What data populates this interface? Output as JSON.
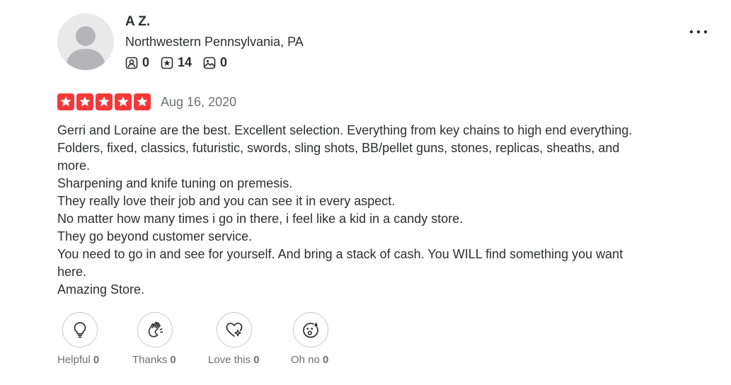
{
  "user": {
    "name": "A Z.",
    "location": "Northwestern Pennsylvania, PA",
    "stats": {
      "friends": "0",
      "reviews": "14",
      "photos": "0"
    }
  },
  "review": {
    "rating": 5,
    "date": "Aug 16, 2020",
    "paragraphs": [
      "Gerri and Loraine are the best. Excellent selection. Everything from key chains to high end everything. Folders, fixed, classics, futuristic, swords, sling shots, BB/pellet guns, stones, replicas, sheaths, and more.",
      "Sharpening and knife tuning on premesis.",
      "They really love their job and you can see it in every aspect.",
      "No matter how many times i go in there, i feel like a kid in a candy store.",
      "They go beyond customer service.",
      "You need to go in and see for yourself. And bring a stack of cash. You WILL find something you want here.",
      "Amazing Store."
    ]
  },
  "reactions": {
    "helpful": {
      "label": "Helpful",
      "count": "0"
    },
    "thanks": {
      "label": "Thanks",
      "count": "0"
    },
    "love": {
      "label": "Love this",
      "count": "0"
    },
    "ohno": {
      "label": "Oh no",
      "count": "0"
    }
  },
  "colors": {
    "star_red": "#f43939",
    "text": "#2d2e2f",
    "muted": "#6e7072",
    "border": "#c8c9ca"
  },
  "icons": {
    "friends": "friends-icon",
    "reviews": "review-star-icon",
    "photos": "photo-icon",
    "more": "more-dots-icon",
    "helpful": "lightbulb-icon",
    "thanks": "clapping-hands-icon",
    "love": "heart-sparkle-icon",
    "ohno": "shocked-face-icon"
  }
}
